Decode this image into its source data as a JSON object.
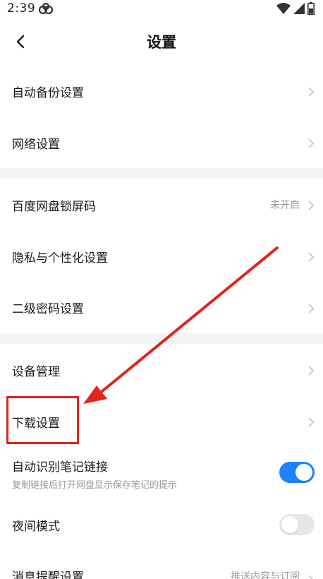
{
  "status_bar": {
    "time": "2:39",
    "icons": [
      "app-notification-icon",
      "wifi-icon",
      "signal-icon",
      "battery-icon"
    ]
  },
  "header": {
    "title": "设置",
    "back_icon": "chevron-left-icon"
  },
  "groups": [
    {
      "items": [
        {
          "label": "自动备份设置",
          "value": ""
        },
        {
          "label": "网络设置",
          "value": ""
        }
      ]
    },
    {
      "items": [
        {
          "label": "百度网盘锁屏码",
          "value": "未开启"
        },
        {
          "label": "隐私与个性化设置",
          "value": ""
        },
        {
          "label": "二级密码设置",
          "value": ""
        }
      ]
    },
    {
      "items": [
        {
          "label": "设备管理",
          "value": ""
        },
        {
          "label": "下载设置",
          "value": ""
        }
      ]
    }
  ],
  "toggles": [
    {
      "label": "自动识别笔记链接",
      "sub": "复制链接后打开网盘显示保存笔记的提示",
      "on": true
    },
    {
      "label": "夜间模式",
      "sub": "",
      "on": false
    }
  ],
  "message_settings": {
    "label": "消息提醒设置",
    "value": "推送内容与订阅"
  },
  "colors": {
    "accent": "#1f83ff",
    "annotation": "#e2231a",
    "divider": "#f3f4f6"
  }
}
